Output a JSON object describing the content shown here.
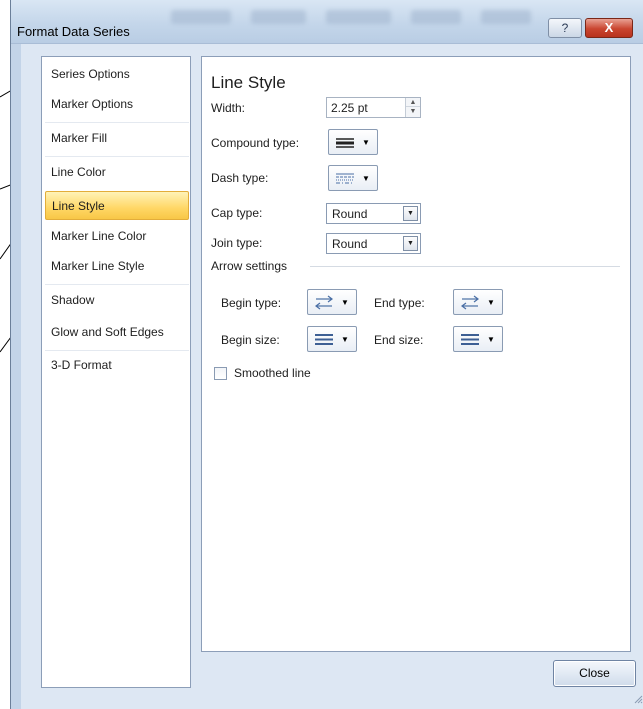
{
  "dialog": {
    "title": "Format Data Series",
    "help_glyph": "?",
    "close_glyph": "X"
  },
  "nav": {
    "items": [
      {
        "label": "Series Options"
      },
      {
        "label": "Marker Options"
      },
      {
        "label": "Marker Fill"
      },
      {
        "label": "Line Color"
      },
      {
        "label": "Line Style",
        "selected": true
      },
      {
        "label": "Marker Line Color"
      },
      {
        "label": "Marker Line Style"
      },
      {
        "label": "Shadow"
      },
      {
        "label": "Glow and Soft Edges"
      },
      {
        "label": "3-D Format"
      }
    ]
  },
  "line_style": {
    "heading": "Line Style",
    "width_label": "Width:",
    "width_value": "2.25 pt",
    "compound_label": "Compound type:",
    "compound_icon": "compound-lines-icon",
    "dash_label": "Dash type:",
    "dash_icon": "dash-lines-icon",
    "cap_label": "Cap type:",
    "cap_value": "Round",
    "join_label": "Join type:",
    "join_value": "Round",
    "arrow_settings_label": "Arrow settings",
    "begin_type_label": "Begin type:",
    "end_type_label": "End type:",
    "begin_size_label": "Begin size:",
    "end_size_label": "End size:",
    "arrow_type_icon": "arrow-type-icon",
    "arrow_size_icon": "arrow-size-icon",
    "smoothed_label": "Smoothed line",
    "smoothed_checked": false
  },
  "footer": {
    "close_label": "Close"
  },
  "colors": {
    "window_frame": "#c3d4e8",
    "client_bg": "#dde7f3",
    "selected_item": "#ffd766",
    "close_button_red": "#c9452f"
  }
}
